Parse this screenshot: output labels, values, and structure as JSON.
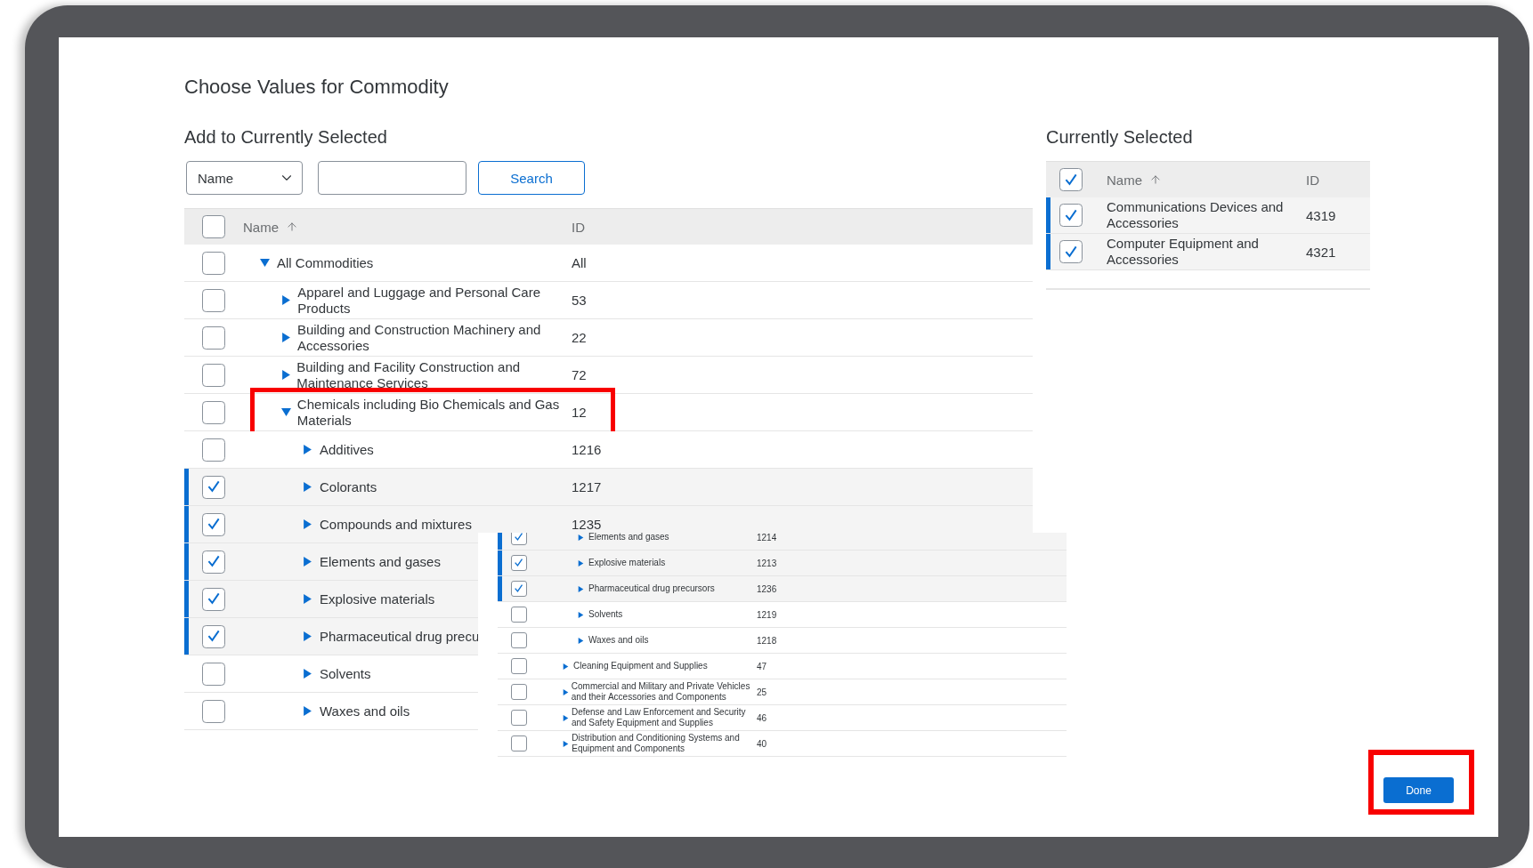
{
  "dialog": {
    "title": "Choose Values for Commodity"
  },
  "add_section": {
    "heading": "Add to Currently Selected",
    "filter": {
      "value": "Name"
    },
    "search_button": "Search",
    "table": {
      "header": {
        "checked": false,
        "name": "Name",
        "id": "ID"
      },
      "rows": [
        {
          "name": "All Commodities",
          "id": "All",
          "checked": false,
          "expanded": true,
          "children": [
            {
              "name": "Apparel and Luggage and Personal Care Products",
              "id": "53",
              "checked": false,
              "expanded": false
            },
            {
              "name": "Building and Construction Machinery and Accessories",
              "id": "22",
              "checked": false,
              "expanded": false
            },
            {
              "name": "Building and Facility Construction and Maintenance Services",
              "id": "72",
              "checked": false,
              "expanded": false
            },
            {
              "name": "Chemicals including Bio Chemicals and Gas Materials",
              "id": "12",
              "checked": false,
              "expanded": true,
              "highlighted": true,
              "children": [
                {
                  "name": "Additives",
                  "id": "1216",
                  "checked": false,
                  "expanded": false
                },
                {
                  "name": "Colorants",
                  "id": "1217",
                  "checked": true,
                  "expanded": false
                },
                {
                  "name": "Compounds and mixtures",
                  "id": "1235",
                  "checked": true,
                  "expanded": false
                },
                {
                  "name": "Elements and gases",
                  "checked": true,
                  "expanded": false
                },
                {
                  "name": "Explosive materials",
                  "checked": true,
                  "expanded": false
                },
                {
                  "name": "Pharmaceutical drug precu",
                  "checked": true,
                  "expanded": false
                },
                {
                  "name": "Solvents",
                  "checked": false,
                  "expanded": false
                },
                {
                  "name": "Waxes and oils",
                  "checked": false,
                  "expanded": false
                }
              ]
            }
          ]
        }
      ]
    },
    "overlay_table": {
      "rows": [
        {
          "kind": "group",
          "children": [
            {
              "kind": "item",
              "name": "Elements and gases",
              "id": "1214",
              "checked": true,
              "expanded": false
            },
            {
              "kind": "item",
              "name": "Explosive materials",
              "id": "1213",
              "checked": true,
              "expanded": false
            },
            {
              "kind": "item",
              "name": "Pharmaceutical drug precursors",
              "id": "1236",
              "checked": true,
              "expanded": false
            },
            {
              "kind": "item",
              "name": "Solvents",
              "id": "1219",
              "checked": false,
              "expanded": false
            },
            {
              "kind": "item",
              "name": "Waxes and oils",
              "id": "1218",
              "checked": false,
              "expanded": false
            }
          ]
        },
        {
          "kind": "item",
          "name": "Cleaning Equipment and Supplies",
          "id": "47",
          "checked": false,
          "expanded": false
        },
        {
          "kind": "item",
          "name": "Commercial and Military and Private Vehicles and their Accessories and Components",
          "id": "25",
          "checked": false,
          "expanded": false
        },
        {
          "kind": "item",
          "name": "Defense and Law Enforcement and Security and Safety Equipment and Supplies",
          "id": "46",
          "checked": false,
          "expanded": false
        },
        {
          "kind": "item",
          "name": "Distribution and Conditioning Systems and Equipment and Components",
          "id": "40",
          "checked": false,
          "expanded": false
        }
      ]
    }
  },
  "selected_section": {
    "heading": "Currently Selected",
    "table": {
      "header": {
        "checked": true,
        "name": "Name",
        "id": "ID"
      },
      "rows": [
        {
          "name": "Communications Devices and Accessories",
          "id": "4319",
          "checked": true
        },
        {
          "name": "Computer Equipment and Accessories",
          "id": "4321",
          "checked": true
        }
      ]
    }
  },
  "done_button": {
    "label": "Done",
    "highlighted": true
  }
}
